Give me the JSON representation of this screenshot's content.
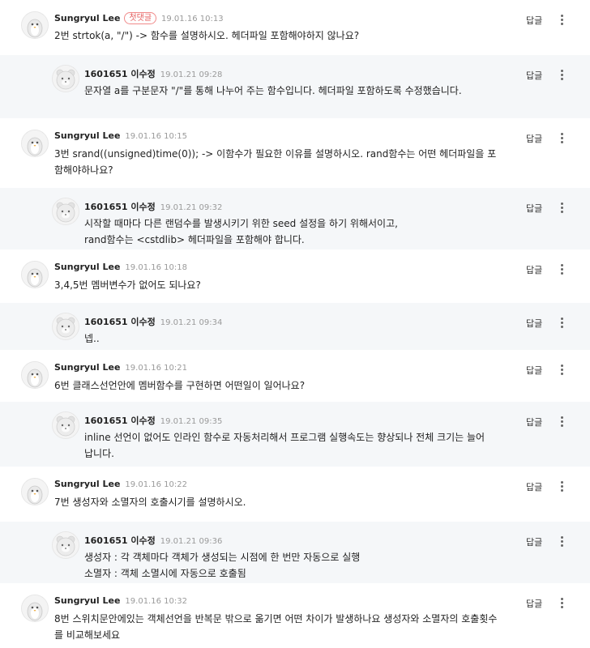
{
  "comments": [
    {
      "type": "top",
      "author": "Sungryul Lee",
      "badge": "첫댓글",
      "time": "19.01.16 10:13",
      "text": "2번 strtok(a, \"/\") -> 함수를 설명하시오. 헤더파일 포함해야하지 않나요?",
      "reply_label": "답글",
      "avatar": "penguin-avatar"
    },
    {
      "type": "reply",
      "author": "1601651 이수정",
      "badge": "",
      "time": "19.01.21 09:28",
      "text": "문자열 a를 구분문자 \"/\"를 통해 나누어 주는 함수입니다. 헤더파일 포함하도록 수정했습니다.",
      "reply_label": "답글",
      "avatar": "bear-avatar"
    },
    {
      "type": "top",
      "author": "Sungryul Lee",
      "badge": "",
      "time": "19.01.16 10:15",
      "text": "3번 srand((unsigned)time(0)); -> 이함수가 필요한 이유를 설명하시오. rand함수는 어떤 헤더파일을 포함해야하나요?",
      "reply_label": "답글",
      "avatar": "penguin-avatar"
    },
    {
      "type": "reply",
      "author": "1601651 이수정",
      "badge": "",
      "time": "19.01.21 09:32",
      "text": "시작할 때마다 다른 랜덤수를 발생시키기 위한 seed 설정을 하기 위해서이고,\nrand함수는 <cstdlib> 헤더파일을 포함해야 합니다.",
      "reply_label": "답글",
      "avatar": "bear-avatar"
    },
    {
      "type": "top",
      "author": "Sungryul Lee",
      "badge": "",
      "time": "19.01.16 10:18",
      "text": "3,4,5번 멤버변수가 없어도 되나요?",
      "reply_label": "답글",
      "avatar": "penguin-avatar"
    },
    {
      "type": "reply",
      "author": "1601651 이수정",
      "badge": "",
      "time": "19.01.21 09:34",
      "text": "넵..",
      "reply_label": "답글",
      "avatar": "bear-avatar"
    },
    {
      "type": "top",
      "author": "Sungryul Lee",
      "badge": "",
      "time": "19.01.16 10:21",
      "text": "6번 클래스선언안에 멤버함수를 구현하면 어떤일이 일어나요?",
      "reply_label": "답글",
      "avatar": "penguin-avatar"
    },
    {
      "type": "reply",
      "author": "1601651 이수정",
      "badge": "",
      "time": "19.01.21 09:35",
      "text": "inline 선언이 없어도 인라인 함수로 자동처리해서 프로그램 실행속도는 향상되나 전체 크기는 늘어납니다.",
      "reply_label": "답글",
      "avatar": "bear-avatar"
    },
    {
      "type": "top",
      "author": "Sungryul Lee",
      "badge": "",
      "time": "19.01.16 10:22",
      "text": "7번 생성자와 소멸자의 호출시기를 설명하시오.",
      "reply_label": "답글",
      "avatar": "penguin-avatar"
    },
    {
      "type": "reply",
      "author": "1601651 이수정",
      "badge": "",
      "time": "19.01.21 09:36",
      "text": "생성자 : 각 객체마다 객체가 생성되는 시점에 한 번만 자동으로 실행\n소멸자 : 객체 소멸시에 자동으로 호출됨",
      "reply_label": "답글",
      "avatar": "bear-avatar"
    },
    {
      "type": "top",
      "author": "Sungryul Lee",
      "badge": "",
      "time": "19.01.16 10:32",
      "text": "8번 스위치문안에있는 객체선언을 반복문 밖으로 옮기면 어떤 차이가 발생하나요 생성자와 소멸자의 호출횟수를 비교해보세요",
      "reply_label": "답글",
      "avatar": "penguin-avatar"
    }
  ]
}
